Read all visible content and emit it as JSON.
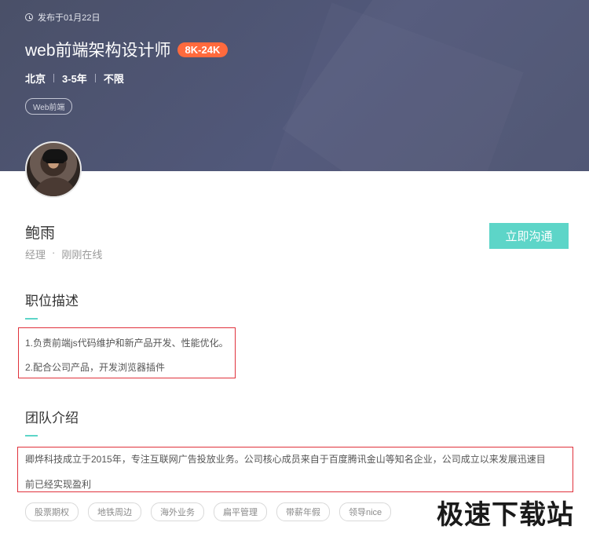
{
  "header": {
    "publish_date": "发布于01月22日",
    "job_title": "web前端架构设计师",
    "salary": "8K-24K",
    "location": "北京",
    "experience": "3-5年",
    "education": "不限",
    "tag": "Web前端"
  },
  "recruiter": {
    "name": "鲍雨",
    "role": "经理",
    "dot": "·",
    "status": "刚刚在线",
    "chat_label": "立即沟通"
  },
  "job_description": {
    "title": "职位描述",
    "lines": [
      "1.负责前端js代码维护和新产品开发、性能优化。",
      "2.配合公司产品，开发浏览器插件"
    ]
  },
  "team": {
    "title": "团队介绍",
    "lines": [
      "卿烨科技成立于2015年，专注互联网广告投放业务。公司核心成员来自于百度腾讯金山等知名企业，公司成立以来发展迅速目",
      "前已经实现盈利"
    ],
    "benefits": [
      "股票期权",
      "地铁周边",
      "海外业务",
      "扁平管理",
      "带薪年假",
      "领导nice"
    ]
  },
  "watermark": "极速下载站",
  "colors": {
    "accent": "#5dd5c8",
    "salary_badge": "#ff6a3d",
    "highlight_border": "#e0323c",
    "header_bg": "#4d5370"
  }
}
